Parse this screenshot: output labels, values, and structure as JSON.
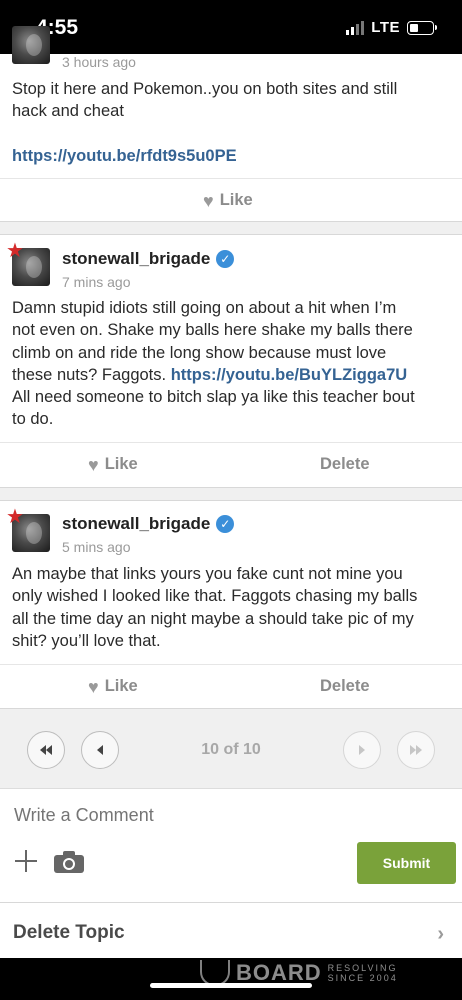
{
  "status_bar": {
    "time": "4:55",
    "network": "LTE"
  },
  "posts": [
    {
      "timestamp": "3 hours ago",
      "text_lines": [
        "Stop it here and Pokemon..you on both sites and still",
        "hack and cheat"
      ],
      "link": "https://youtu.be/rfdt9s5u0PE",
      "like_label": "Like"
    },
    {
      "username": "stonewall_brigade",
      "timestamp": "7 mins ago",
      "text_lines": [
        "Damn stupid idiots still going on about a hit when I’m",
        "not even on. Shake my balls here shake my balls there",
        "climb on and ride the long show because must love",
        "these nuts? Faggots.",
        "All need someone to bitch slap ya like this teacher bout",
        "to do."
      ],
      "link": "https://youtu.be/BuYLZigga7U",
      "like_label": "Like",
      "delete_label": "Delete"
    },
    {
      "username": "stonewall_brigade",
      "timestamp": "5 mins ago",
      "text_lines": [
        "An maybe that links yours you fake cunt not mine you",
        "only wished I looked like that. Faggots chasing my balls",
        "all the time day an night maybe a should take pic of my",
        "shit? you’ll love that."
      ],
      "like_label": "Like",
      "delete_label": "Delete"
    }
  ],
  "pager": {
    "label": "10 of 10"
  },
  "comment": {
    "placeholder": "Write a Comment",
    "submit_label": "Submit"
  },
  "delete_topic": {
    "label": "Delete Topic"
  },
  "watermark": {
    "brand": "BOARD",
    "sub1": "RESOLVING",
    "sub2": "SINCE 2004"
  },
  "colors": {
    "link": "#356393",
    "submit": "#7aa23a",
    "verified": "#3b8fd9",
    "star": "#d42a2a"
  }
}
